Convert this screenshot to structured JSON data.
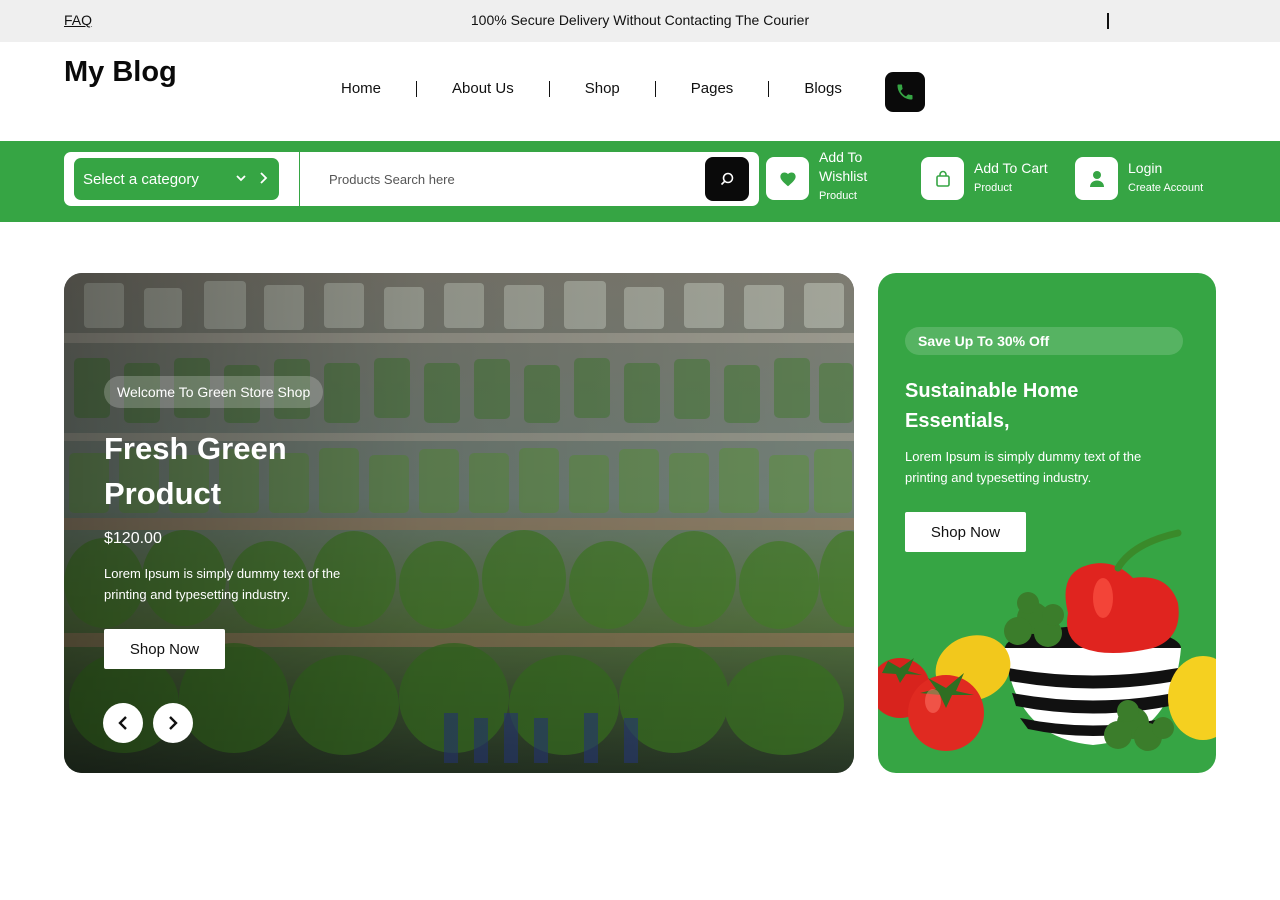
{
  "topbar": {
    "faq": "FAQ",
    "notice": "100% Secure Delivery Without Contacting The Courier"
  },
  "header": {
    "logo": "My Blog",
    "nav": [
      "Home",
      "About Us",
      "Shop",
      "Pages",
      "Blogs"
    ],
    "phone_icon": "phone-icon"
  },
  "search": {
    "category": "Select a category",
    "placeholder": "Products Search here",
    "search_icon": "search-icon"
  },
  "actions": {
    "wishlist": {
      "title": "Add To Wishlist",
      "sub": "Product",
      "icon": "heart-icon"
    },
    "cart": {
      "title": "Add To Cart",
      "sub": "Product",
      "icon": "bag-icon"
    },
    "login": {
      "title": "Login",
      "sub": "Create Account",
      "icon": "user-icon"
    }
  },
  "hero": {
    "badge": "Welcome To Green Store Shop",
    "title": "Fresh Green Product",
    "price": "$120.00",
    "description": "Lorem Ipsum is simply dummy text of the printing and typesetting industry.",
    "button": "Shop Now"
  },
  "promo": {
    "badge": "Save Up To 30% Off",
    "title": "Sustainable Home Essentials,",
    "description": "Lorem Ipsum is simply dummy text of the printing and typesetting industry.",
    "button": "Shop Now"
  },
  "colors": {
    "brand_green": "#36a544",
    "dark": "#0a0a0a",
    "topbar_bg": "#efefef"
  }
}
